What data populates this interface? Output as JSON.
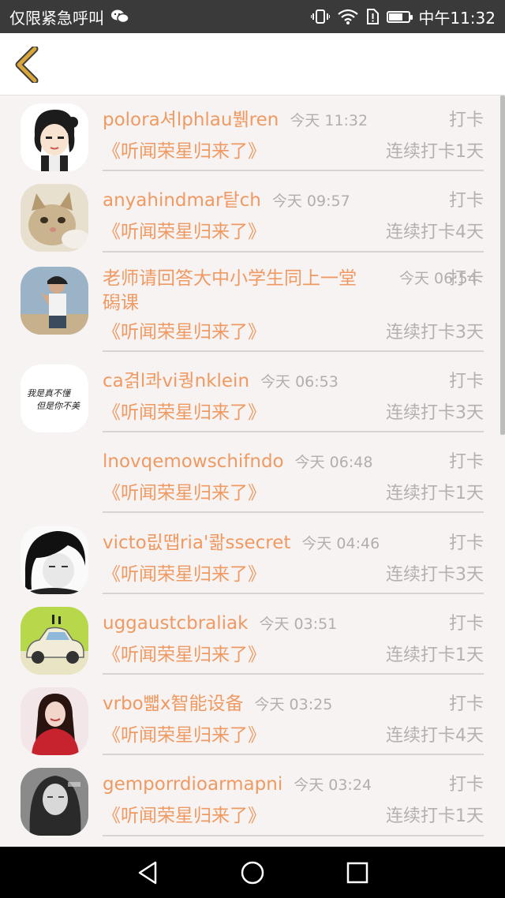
{
  "status_bar": {
    "left_text": "仅限紧急呼叫",
    "time": "中午11:32",
    "battery_level": 0.7
  },
  "colors": {
    "accent": "#ef9a62",
    "muted": "#b5b0b0",
    "back_arrow": "#d9a63b"
  },
  "records": [
    {
      "name": "polora셔lphlau뷁ren",
      "time": "今天 11:32",
      "action": "打卡",
      "album": "《听闻荣星归来了》",
      "streak": "连续打卡1天",
      "avatar": "cartoon-avatar"
    },
    {
      "name": "anyahindmar탙ch",
      "time": "今天 09:57",
      "action": "打卡",
      "album": "《听闻荣星归来了》",
      "streak": "连续打卡4天",
      "avatar": "cat-avatar"
    },
    {
      "name": "老师请回答大中小学生同上一堂磶课",
      "time": "今天 06:54",
      "action": "打卡",
      "album": "《听闻荣星归来了》",
      "streak": "连续打卡3天",
      "avatar": "boy-avatar"
    },
    {
      "name": "ca겱l콰vi퀑nklein",
      "time": "今天 06:53",
      "action": "打卡",
      "album": "《听闻荣星归来了》",
      "streak": "连续打卡3天",
      "avatar": "calligraphy-avatar"
    },
    {
      "name": "lnovqemowschifndo",
      "time": "今天 06:48",
      "action": "打卡",
      "album": "《听闻荣星归来了》",
      "streak": "连续打卡1天",
      "avatar": "blank-avatar"
    },
    {
      "name": "victo릾땝ria'콺ssecret",
      "time": "今天 04:46",
      "action": "打卡",
      "album": "《听闻荣星归来了》",
      "streak": "连续打卡3天",
      "avatar": "dark-hair-avatar"
    },
    {
      "name": "uggaustcbraliak",
      "time": "今天 03:51",
      "action": "打卡",
      "album": "《听闻荣星归来了》",
      "streak": "连续打卡1天",
      "avatar": "toy-car-avatar"
    },
    {
      "name": "vrbo뺿x智能设备",
      "time": "今天 03:25",
      "action": "打卡",
      "album": "《听闻荣星归来了》",
      "streak": "连续打卡4天",
      "avatar": "girl-red-avatar"
    },
    {
      "name": "gemporrdioarmapni",
      "time": "今天 03:24",
      "action": "打卡",
      "album": "《听闻荣星归来了》",
      "streak": "连续打卡1天",
      "avatar": "gray-girl-avatar"
    }
  ]
}
